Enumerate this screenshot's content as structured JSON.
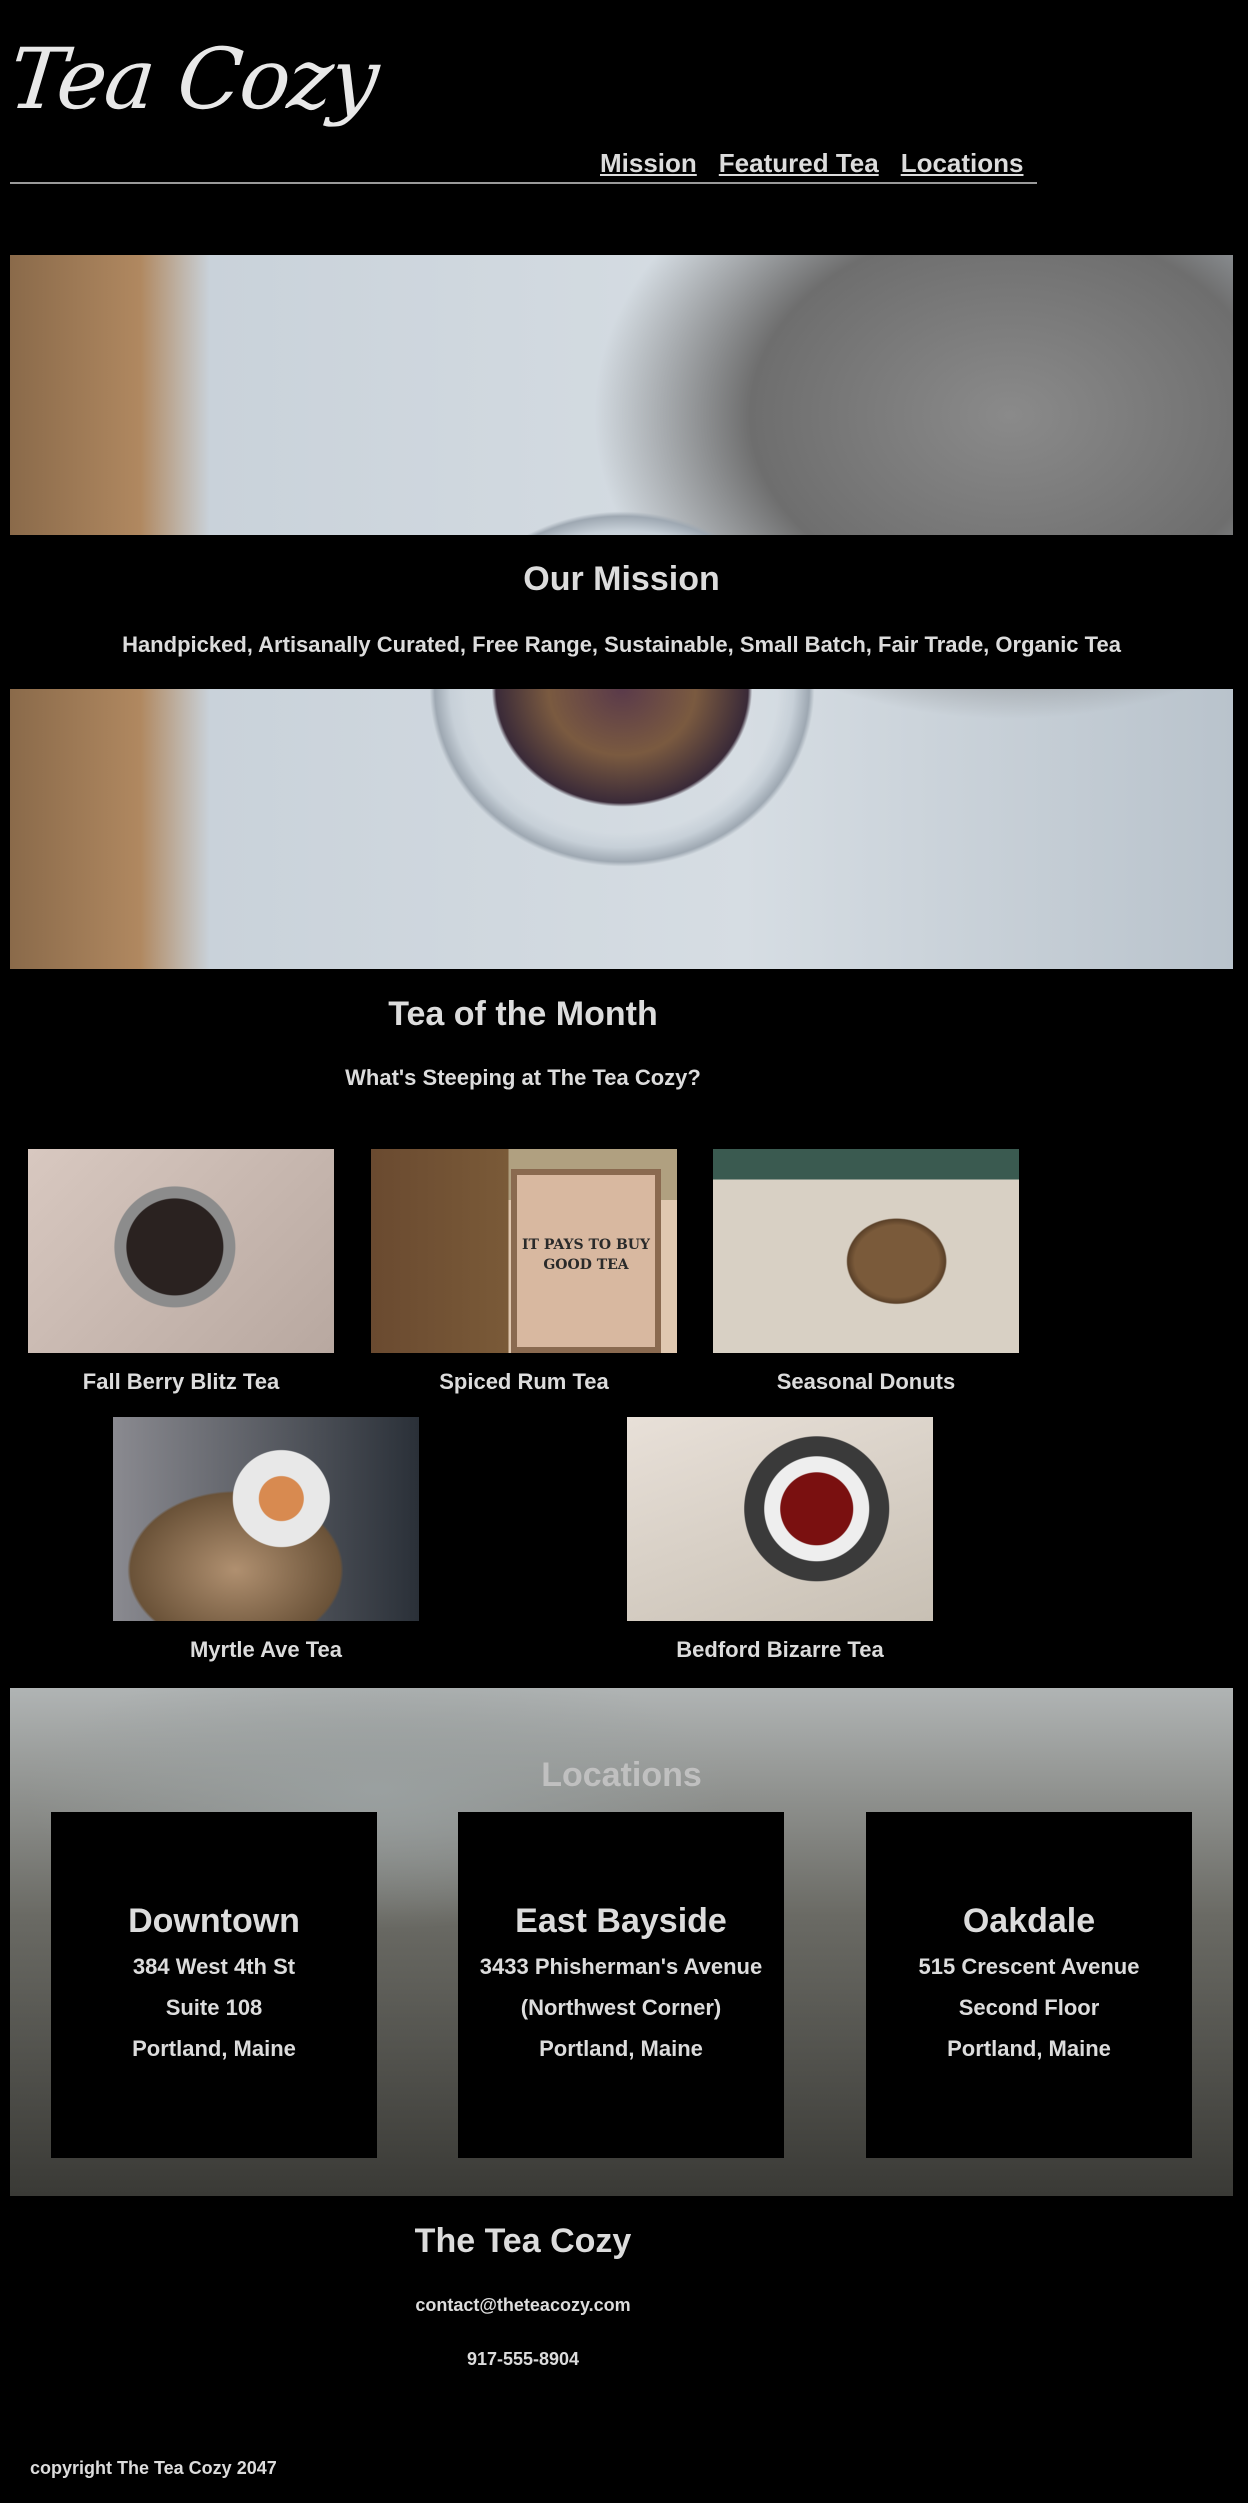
{
  "header": {
    "logo": "Tea Cozy",
    "nav": [
      "Mission",
      "Featured Tea",
      "Locations"
    ]
  },
  "mission": {
    "title": "Our Mission",
    "text": "Handpicked, Artisanally Curated, Free Range, Sustainable, Small Batch, Fair Trade, Organic Tea"
  },
  "featured": {
    "title": "Tea of the Month",
    "subtitle": "What's Steeping at The Tea Cozy?",
    "teas": [
      {
        "name": "Fall Berry Blitz Tea"
      },
      {
        "name": "Spiced Rum Tea",
        "box_text": "IT PAYS TO BUY GOOD TEA"
      },
      {
        "name": "Seasonal Donuts"
      },
      {
        "name": "Myrtle Ave Tea"
      },
      {
        "name": "Bedford Bizarre Tea"
      }
    ]
  },
  "locations": {
    "title": "Locations",
    "items": [
      {
        "name": "Downtown",
        "lines": [
          "384 West 4th St",
          "Suite 108",
          "Portland, Maine"
        ]
      },
      {
        "name": "East Bayside",
        "lines": [
          "3433 Phisherman's Avenue",
          "(Northwest Corner)",
          "Portland, Maine"
        ]
      },
      {
        "name": "Oakdale",
        "lines": [
          "515 Crescent Avenue",
          "Second Floor",
          "Portland, Maine"
        ]
      }
    ]
  },
  "footer": {
    "title": "The Tea Cozy",
    "email": "contact@theteacozy.com",
    "phone": "917-555-8904",
    "copyright": "copyright The Tea Cozy 2047"
  }
}
